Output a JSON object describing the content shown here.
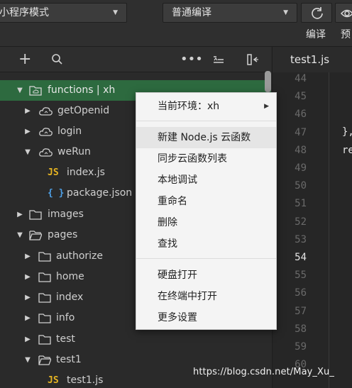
{
  "toolbar": {
    "mode_select": "小程序模式",
    "compile_select": "普通编译",
    "compile_label": "编译",
    "preview_label": "预"
  },
  "editor": {
    "tab": "test1.js",
    "line_numbers": [
      "44",
      "45",
      "46",
      "47",
      "48",
      "49",
      "50",
      "51",
      "52",
      "53",
      "54",
      "55",
      "56",
      "57",
      "58",
      "59",
      "60"
    ],
    "active_line": "54",
    "code_47": "},",
    "code_48": "re"
  },
  "tree": {
    "rows": [
      {
        "label": "functions | xh",
        "type": "cloud-folder",
        "expanded": true
      },
      {
        "label": "getOpenid",
        "type": "cloud"
      },
      {
        "label": "login",
        "type": "cloud"
      },
      {
        "label": "weRun",
        "type": "cloud",
        "expanded": true
      },
      {
        "label": "index.js",
        "type": "js",
        "badge": "JS"
      },
      {
        "label": "package.json",
        "type": "json",
        "badge": "{ }"
      },
      {
        "label": "images",
        "type": "folder"
      },
      {
        "label": "pages",
        "type": "folder",
        "expanded": true
      },
      {
        "label": "authorize",
        "type": "folder"
      },
      {
        "label": "home",
        "type": "folder"
      },
      {
        "label": "index",
        "type": "folder"
      },
      {
        "label": "info",
        "type": "folder"
      },
      {
        "label": "test",
        "type": "folder"
      },
      {
        "label": "test1",
        "type": "folder",
        "expanded": true
      },
      {
        "label": "test1.js",
        "type": "js",
        "badge": "JS"
      }
    ]
  },
  "menu": {
    "items": [
      "当前环境：xh",
      "新建 Node.js 云函数",
      "同步云函数列表",
      "本地调试",
      "重命名",
      "删除",
      "查找",
      "硬盘打开",
      "在终端中打开",
      "更多设置"
    ]
  },
  "watermark": "https://blog.csdn.net/May_Xu_"
}
